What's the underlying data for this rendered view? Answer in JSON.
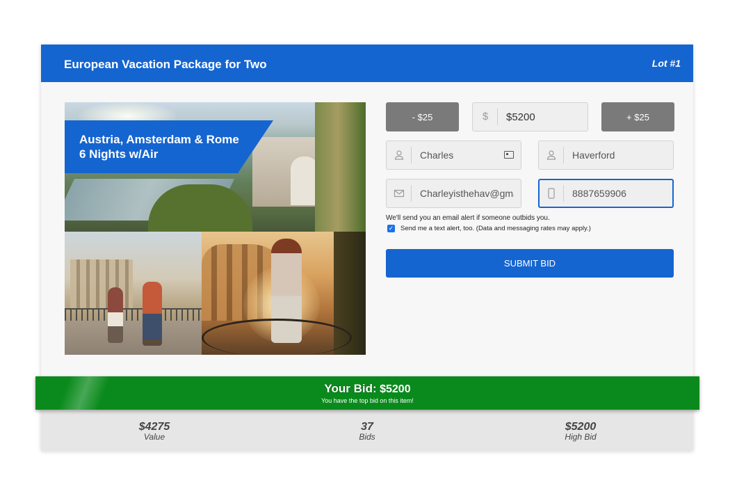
{
  "header": {
    "title": "European Vacation Package for Two",
    "lot": "Lot #1"
  },
  "photo_banner": {
    "line1": "Austria, Amsterdam & Rome",
    "line2": "6 Nights w/Air"
  },
  "bid_controls": {
    "decrement_label": "- $25",
    "increment_label": "+ $25",
    "currency_symbol": "$",
    "amount": "$5200"
  },
  "form": {
    "first_name": "Charles",
    "last_name": "Haverford",
    "email": "Charleyisthehav@gma",
    "phone": "8887659906"
  },
  "email_note": "We'll send you an email alert if someone outbids you.",
  "text_alert": {
    "checked": true,
    "label": "Send me a text alert, too. (Data and messaging rates may apply.)"
  },
  "submit_label": "SUBMIT BID",
  "your_bid": {
    "label": "Your Bid:",
    "amount": "$5200",
    "status": "You have the top bid on this item!"
  },
  "stats": [
    {
      "value": "$4275",
      "label": "Value"
    },
    {
      "value": "37",
      "label": "Bids"
    },
    {
      "value": "$5200",
      "label": "High Bid"
    }
  ],
  "colors": {
    "primary_blue": "#1565d0",
    "banner_green": "#0a8a1c",
    "step_gray": "#7a7a7a"
  }
}
